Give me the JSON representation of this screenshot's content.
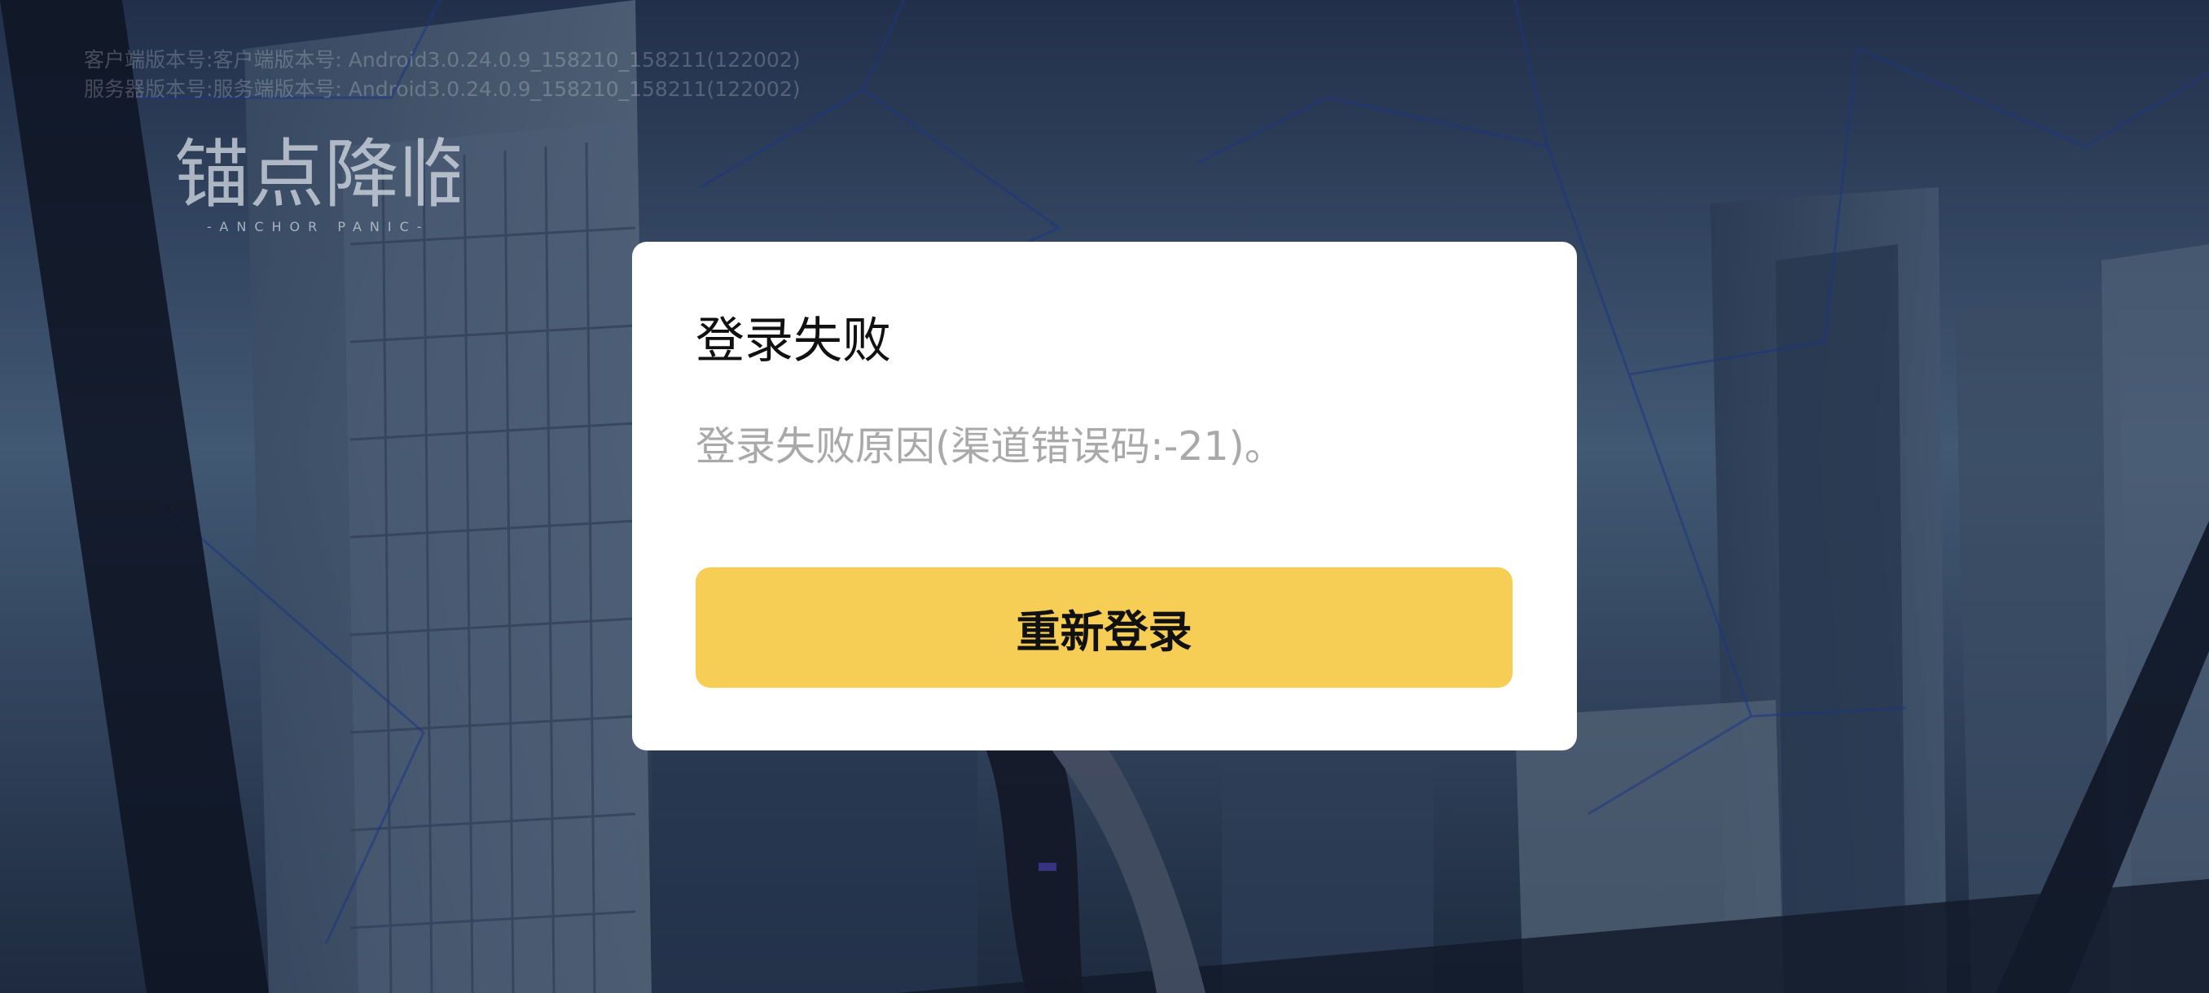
{
  "background": {
    "logo_text": "锚点降临",
    "logo_subtitle": "-ANCHOR PANIC-"
  },
  "version_info": {
    "client_line": "客户端版本号:客户端版本号: Android3.0.24.0.9_158210_158211(122002)",
    "server_line": "服务器版本号:服务端版本号: Android3.0.24.0.9_158210_158211(122002)"
  },
  "dialog": {
    "title": "登录失败",
    "message": "登录失败原因(渠道错误码:-21)。",
    "relogin_label": "重新登录"
  },
  "colors": {
    "dialog_bg": "#ffffff",
    "button_accent": "#f6ce56",
    "message_text": "#a9a9a9"
  }
}
